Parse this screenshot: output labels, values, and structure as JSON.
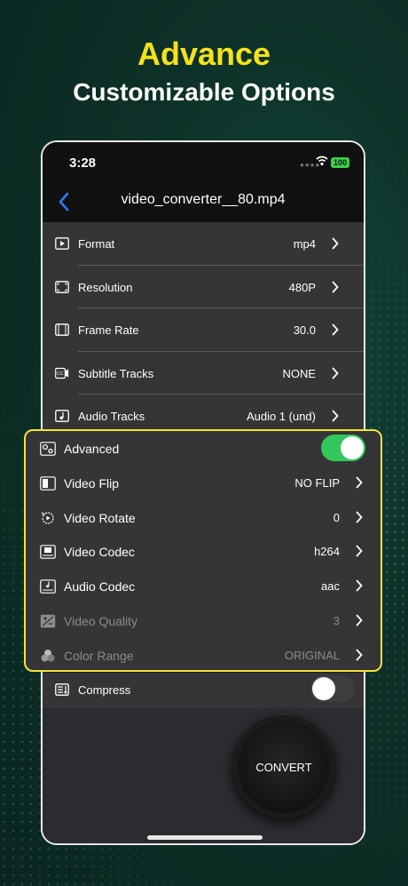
{
  "promo": {
    "headline": "Advance",
    "subheadline": "Customizable Options"
  },
  "status_bar": {
    "time": "3:28",
    "battery": "100"
  },
  "nav": {
    "title": "video_converter__80.mp4"
  },
  "settings": [
    {
      "label": "Format",
      "value": "mp4",
      "icon": "format-icon"
    },
    {
      "label": "Resolution",
      "value": "480P",
      "icon": "resolution-icon"
    },
    {
      "label": "Frame Rate",
      "value": "30.0",
      "icon": "frame-rate-icon"
    },
    {
      "label": "Subtitle Tracks",
      "value": "NONE",
      "icon": "subtitle-icon"
    },
    {
      "label": "Audio Tracks",
      "value": "Audio 1 (und)",
      "icon": "audio-track-icon"
    }
  ],
  "advanced": {
    "label": "Advanced",
    "enabled": true,
    "items": [
      {
        "label": "Video Flip",
        "value": "NO FLIP",
        "icon": "video-flip-icon",
        "disabled": false
      },
      {
        "label": "Video Rotate",
        "value": "0",
        "icon": "video-rotate-icon",
        "disabled": false
      },
      {
        "label": "Video Codec",
        "value": "h264",
        "icon": "video-codec-icon",
        "disabled": false
      },
      {
        "label": "Audio Codec",
        "value": "aac",
        "icon": "audio-codec-icon",
        "disabled": false
      },
      {
        "label": "Video Quality",
        "value": "3",
        "icon": "video-quality-icon",
        "disabled": true
      },
      {
        "label": "Color Range",
        "value": "ORIGINAL",
        "icon": "color-range-icon",
        "disabled": true
      }
    ]
  },
  "compress": {
    "label": "Compress",
    "enabled": false
  },
  "convert": {
    "label": "CONVERT"
  },
  "colors": {
    "accent_yellow": "#f6e21a",
    "highlight_border": "#f3e33a",
    "toggle_on": "#34c759",
    "link_blue": "#2f7cf6"
  }
}
